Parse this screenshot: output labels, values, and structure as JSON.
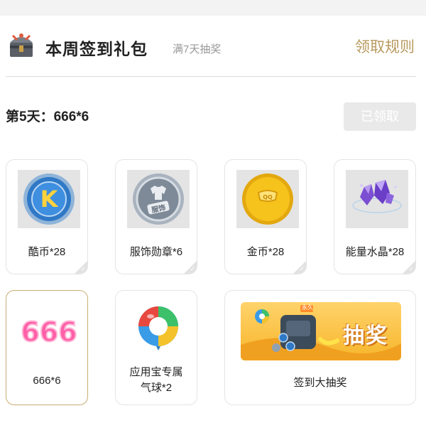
{
  "header": {
    "title": "本周签到礼包",
    "subtitle": "满7天抽奖",
    "rules_label": "领取规则"
  },
  "status": {
    "day_label": "第5天：666*6",
    "claimed_label": "已领取"
  },
  "rewards": [
    {
      "label": "酷币*28",
      "icon": "k-coin-icon",
      "claimed": true
    },
    {
      "label": "服饰勋章*6",
      "icon": "clothing-medal-icon",
      "claimed": true
    },
    {
      "label": "金币*28",
      "icon": "gold-coin-icon",
      "claimed": true
    },
    {
      "label": "能量水晶*28",
      "icon": "energy-crystal-icon",
      "claimed": true
    },
    {
      "label": "666*6",
      "icon": "666-icon",
      "selected": true
    },
    {
      "label": "应用宝专属气球*2",
      "icon": "balloon-icon"
    },
    {
      "label": "签到大抽奖",
      "icon": "lottery-banner",
      "banner_text": "抽奖",
      "tag": "永久"
    }
  ],
  "colors": {
    "accent_gold": "#b79a5e",
    "selected_border": "#c8ae74",
    "banner_yellow": "#f7b52a",
    "pink_666": "#ff5fa8"
  }
}
